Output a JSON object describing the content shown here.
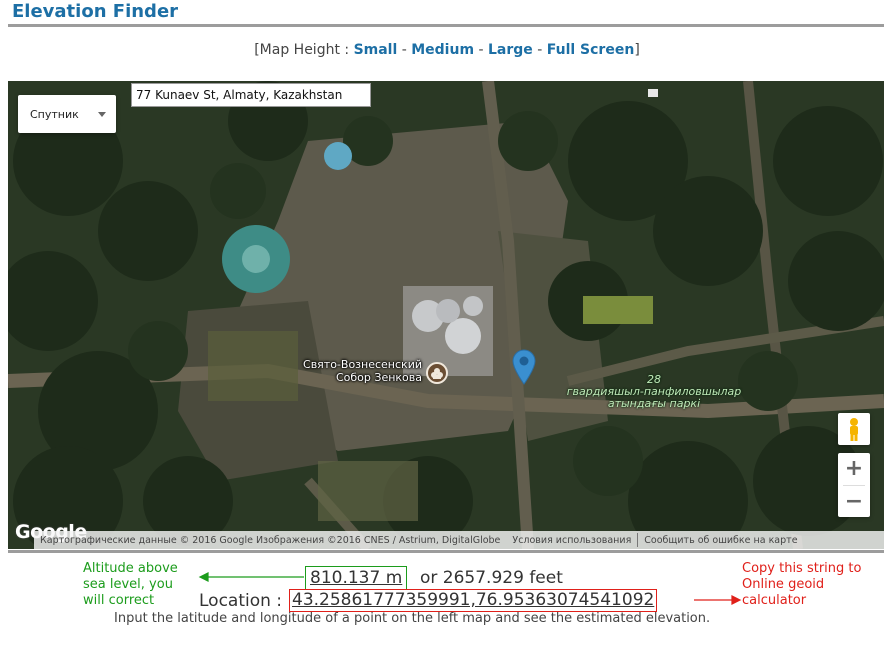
{
  "header": {
    "title": "Elevation Finder"
  },
  "map_height": {
    "prefix": "[Map Height : ",
    "suffix": "]",
    "separator": " - ",
    "options": [
      "Small",
      "Medium",
      "Large",
      "Full Screen"
    ]
  },
  "map": {
    "type_selector": "Спутник",
    "address": "77 Kunaev St, Almaty, Kazakhstan",
    "poi_label_line1": "Свято-Вознесенский",
    "poi_label_line2": "Собор Зенкова",
    "park_label_line1": "28",
    "park_label_line2": "гвардияшыл-панфиловшылар",
    "park_label_line3": "атындағы паркі",
    "logo": "Google",
    "attribution": "Картографические данные © 2016 Google Изображения ©2016 CNES / Astrium, DigitalGlobe",
    "terms_link": "Условия использования",
    "report_link": "Сообщить об ошибке на карте",
    "zoom_in": "+",
    "zoom_out": "−",
    "icons": {
      "pin": "location-pin-icon",
      "pegman": "pegman-icon",
      "poi": "church-icon"
    }
  },
  "result": {
    "altitude_m": "810.137 m",
    "altitude_ft": "or 2657.929 feet",
    "location_label": "Location :",
    "location_value": "43.25861777359991,76.95363074541092",
    "help": "Input the latitude and longitude of a point on the left map and see the estimated elevation."
  },
  "annotations": {
    "green_line1": "Altitude above",
    "green_line2": "sea level, you",
    "green_line3": "will correct",
    "red_line1": "Copy this string to",
    "red_line2": "Online geoid",
    "red_line3": "calculator",
    "green_color": "#1c9c1c",
    "red_color": "#e0201a"
  },
  "colors": {
    "title": "#1d6fa5",
    "link": "#1d6fa5",
    "rule": "#9c9c9c"
  }
}
